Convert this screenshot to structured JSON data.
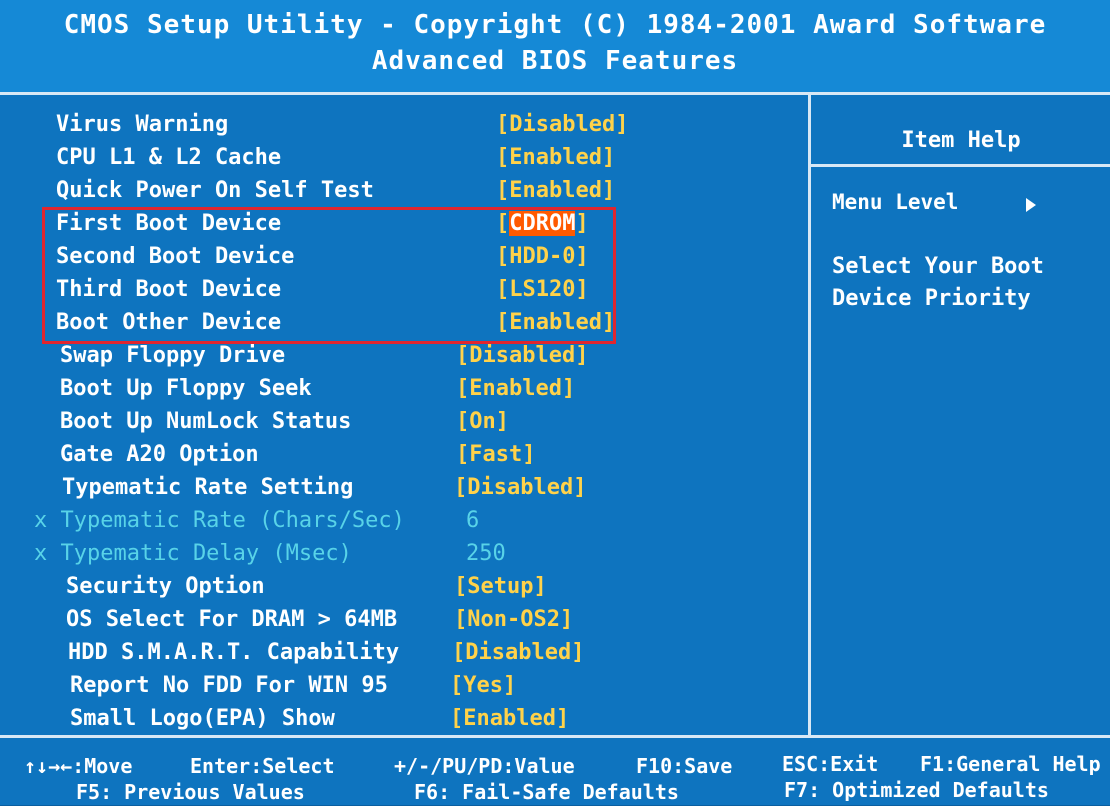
{
  "title": {
    "line1": "CMOS Setup Utility - Copyright (C) 1984-2001 Award Software",
    "line2": "Advanced BIOS Features"
  },
  "settings": [
    {
      "label": "Virus Warning",
      "value": "[Disabled]"
    },
    {
      "label": "CPU L1 & L2 Cache",
      "value": "[Enabled]"
    },
    {
      "label": "Quick Power On Self Test",
      "value": "[Enabled]"
    },
    {
      "label": "First Boot Device",
      "value_open": "[",
      "value_selected": "CDROM",
      "value_close": "]"
    },
    {
      "label": "Second Boot Device",
      "value": "[HDD-0]"
    },
    {
      "label": "Third Boot Device",
      "value": "[LS120]"
    },
    {
      "label": "Boot Other Device",
      "value": "[Enabled]"
    },
    {
      "label": "Swap Floppy Drive",
      "value": "[Disabled]"
    },
    {
      "label": "Boot Up Floppy Seek",
      "value": "[Enabled]"
    },
    {
      "label": "Boot Up NumLock Status",
      "value": "[On]"
    },
    {
      "label": "Gate A20 Option",
      "value": "[Fast]"
    },
    {
      "label": "Typematic Rate Setting",
      "value": "[Disabled]"
    },
    {
      "label": "x Typematic Rate (Chars/Sec)",
      "value": "6"
    },
    {
      "label": "x Typematic Delay (Msec)",
      "value": "250"
    },
    {
      "label": "Security Option",
      "value": "[Setup]"
    },
    {
      "label": "OS Select For DRAM > 64MB",
      "value": "[Non-OS2]"
    },
    {
      "label": "HDD S.M.A.R.T. Capability",
      "value": "[Disabled]"
    },
    {
      "label": "Report No FDD For WIN 95",
      "value": "[Yes]"
    },
    {
      "label": "Small Logo(EPA) Show",
      "value": "[Enabled]"
    }
  ],
  "help": {
    "title": "Item Help",
    "menu_level": "Menu Level",
    "text_line1": "Select Your Boot",
    "text_line2": "Device Priority"
  },
  "footer": {
    "move": "↑↓→←:Move",
    "enter": "Enter:Select",
    "value": "+/-/PU/PD:Value",
    "save": "F10:Save",
    "exit": "ESC:Exit",
    "general_help": "F1:General Help",
    "f5": "F5: Previous Values",
    "f6": "F6: Fail-Safe Defaults",
    "f7": "F7: Optimized Defaults"
  },
  "colors": {
    "background": "#0e74bf",
    "value_text": "#ffd24a",
    "disabled_text": "#58d3e8",
    "selected_bg": "#ff5a00",
    "highlight_border": "#e0262f"
  }
}
